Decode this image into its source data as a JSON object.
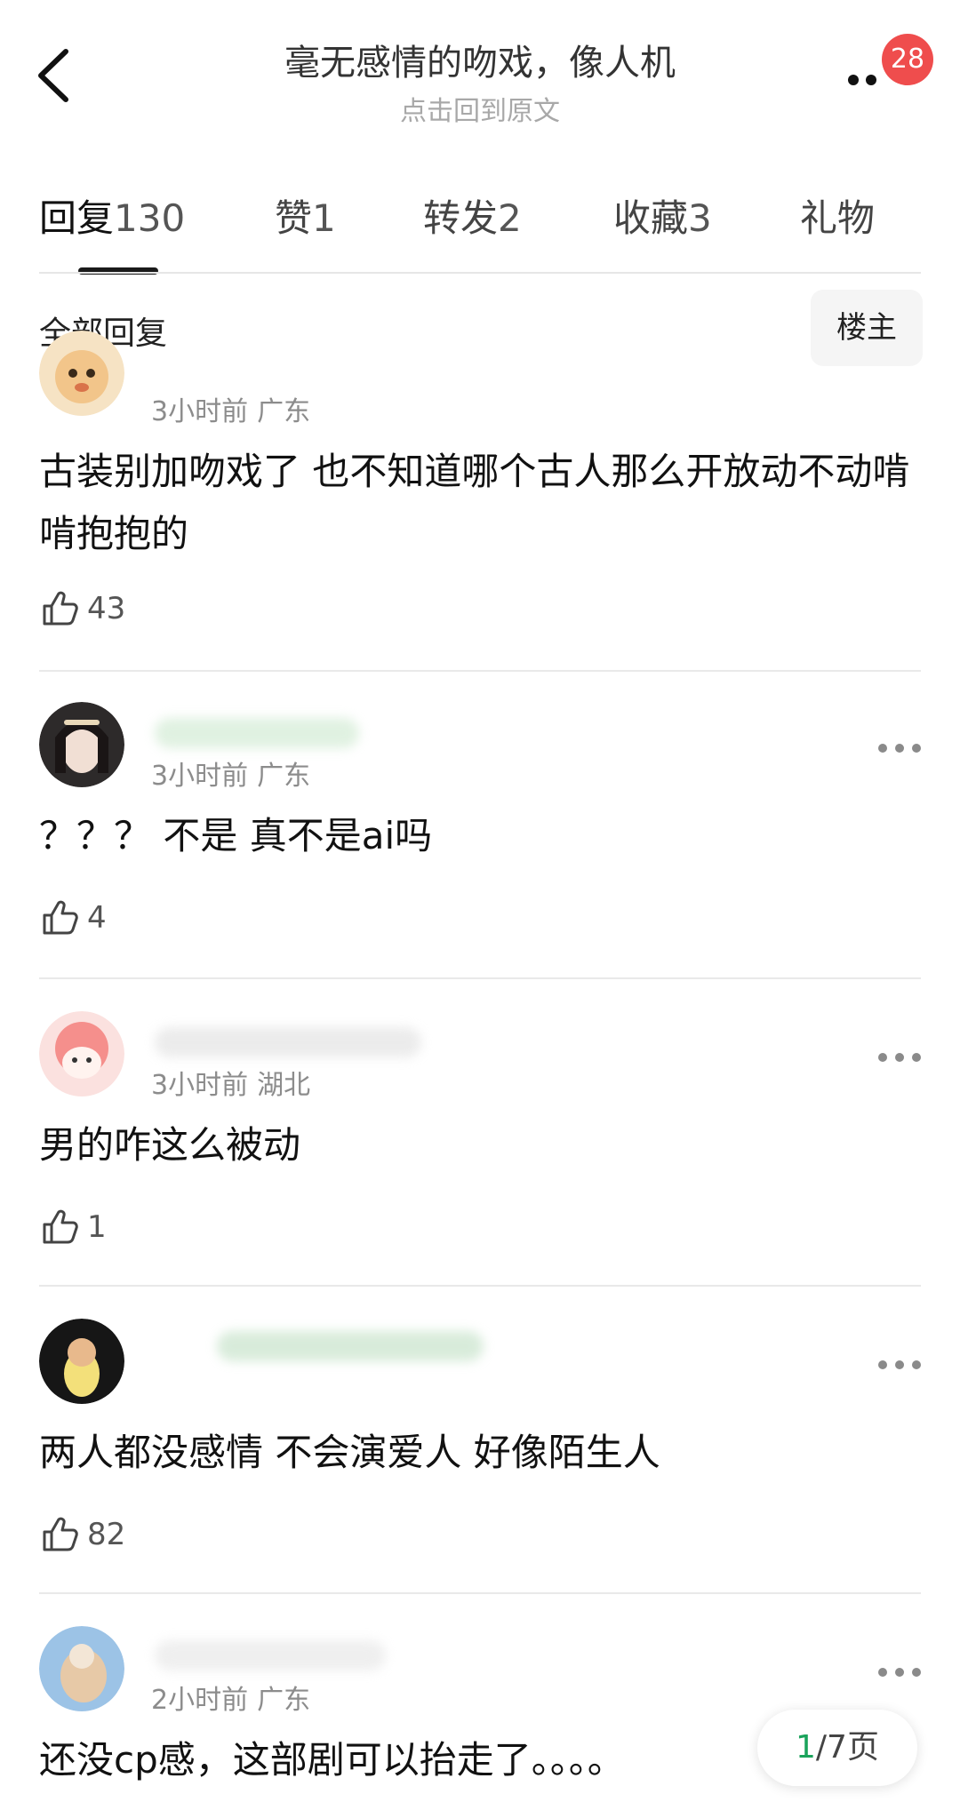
{
  "header": {
    "title": "毫无感情的吻戏，像人机",
    "subtitle": "点击回到原文",
    "badge_count": "28"
  },
  "tabs": [
    {
      "label": "回复",
      "count": "130",
      "active": true
    },
    {
      "label": "赞",
      "count": "1"
    },
    {
      "label": "转发",
      "count": "2"
    },
    {
      "label": "收藏",
      "count": "3"
    },
    {
      "label": "礼物",
      "count": ""
    }
  ],
  "filter": {
    "label": "全部回复",
    "owner_button": "楼主"
  },
  "comments": [
    {
      "time": "3小时前",
      "location": "广东",
      "text": "古装别加吻戏了  也不知道哪个古人那么开放动不动啃啃抱抱的",
      "likes": "43"
    },
    {
      "time": "3小时前",
      "location": "广东",
      "text": "？？？ 不是 真不是ai吗",
      "likes": "4"
    },
    {
      "time": "3小时前",
      "location": "湖北",
      "text": "男的咋这么被动",
      "likes": "1"
    },
    {
      "time": "",
      "location": "",
      "text": "两人都没感情 不会演爱人  好像陌生人",
      "likes": "82"
    },
    {
      "time": "2小时前",
      "location": "广东",
      "text": "还没cp感，这部剧可以抬走了。。。。",
      "likes": ""
    }
  ],
  "pagination": {
    "current": "1",
    "total": "/7页"
  },
  "colors": {
    "badge": "#ef4d4d",
    "page_current": "#1aa35b",
    "text": "#111111",
    "meta": "#8c8c8c"
  }
}
